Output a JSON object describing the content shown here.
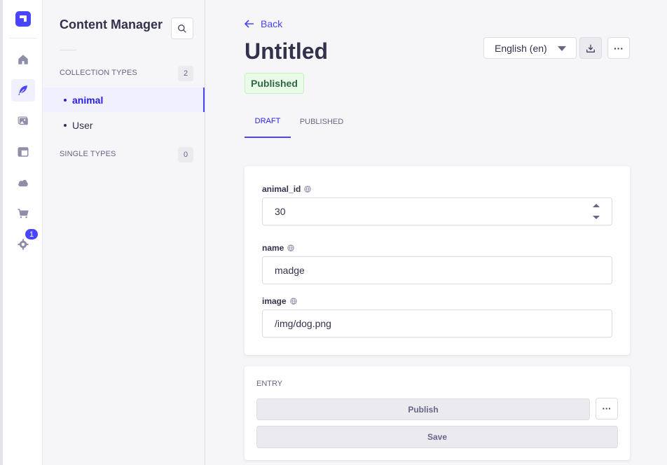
{
  "rail": {
    "badge_count": "1",
    "items": [
      {
        "icon": "home-icon"
      },
      {
        "icon": "feather-icon",
        "active": true
      },
      {
        "icon": "media-icon"
      },
      {
        "icon": "layout-icon"
      },
      {
        "icon": "cloud-icon"
      },
      {
        "icon": "cart-icon"
      },
      {
        "icon": "gear-icon"
      }
    ],
    "accent": "#4945ff"
  },
  "subnav": {
    "title": "Content Manager",
    "collection_types": {
      "label": "COLLECTION TYPES",
      "count": "2",
      "items": [
        {
          "label": "animal",
          "active": true
        },
        {
          "label": "User",
          "active": false
        }
      ]
    },
    "single_types": {
      "label": "SINGLE TYPES",
      "count": "0"
    }
  },
  "header": {
    "back_label": "Back",
    "title": "Untitled",
    "status": "Published",
    "locale": "English (en)",
    "more_label": "···"
  },
  "tabs": [
    {
      "label": "DRAFT",
      "active": true
    },
    {
      "label": "PUBLISHED",
      "active": false
    }
  ],
  "fields": [
    {
      "label": "animal_id",
      "value": "30",
      "type": "number"
    },
    {
      "label": "name",
      "value": "madge",
      "type": "text"
    },
    {
      "label": "image",
      "value": "/img/dog.png",
      "type": "text"
    }
  ],
  "entry": {
    "title": "ENTRY",
    "publish_label": "Publish",
    "save_label": "Save",
    "more_label": "···"
  }
}
